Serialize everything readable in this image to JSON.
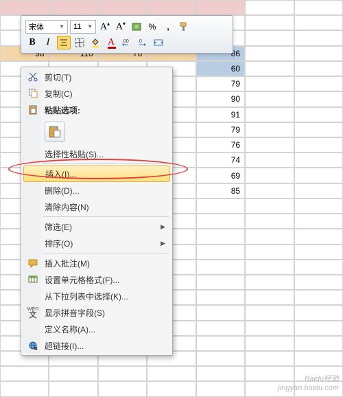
{
  "toolbar": {
    "font_name": "宋体",
    "font_size": "11",
    "percent": "%",
    "comma": ","
  },
  "grid": {
    "row1": {
      "c1": "98",
      "c2": "110",
      "c3": "76",
      "c4": "86"
    },
    "vals": [
      "60",
      "79",
      "90",
      "91",
      "79",
      "76",
      "74",
      "69",
      "85"
    ]
  },
  "menu": {
    "cut": "剪切(T)",
    "copy": "复制(C)",
    "paste_options": "粘贴选项:",
    "paste_special": "选择性粘贴(S)...",
    "insert": "插入(I)...",
    "delete": "删除(D)...",
    "clear": "清除内容(N)",
    "filter": "筛选(E)",
    "sort": "排序(O)",
    "insert_comment": "插入批注(M)",
    "format_cells": "设置单元格格式(F)...",
    "dropdown_list": "从下拉列表中选择(K)...",
    "pinyin": "显示拼音字段(S)",
    "define_name": "定义名称(A)...",
    "hyperlink": "超链接(I)..."
  },
  "watermark": {
    "l1": "Baidu经验",
    "l2": "jingyan.baidu.com"
  }
}
